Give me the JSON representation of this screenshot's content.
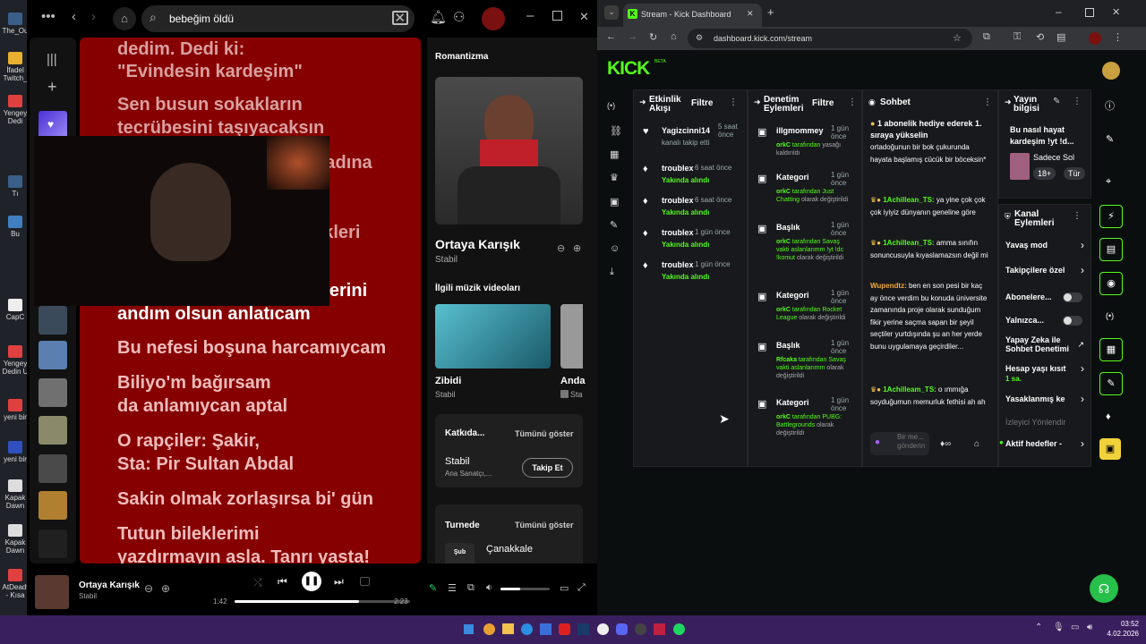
{
  "desktop": {
    "icons": [
      "The_Ou",
      "İfadel Twitch_",
      "Yengey Dedi",
      "Tı",
      "Bu",
      "CapC",
      "Yengey Dedin U",
      "yeni bir",
      "yeni bir",
      "Kapak Dawn",
      "Kapak Dawn",
      "AtDeadt - Kısa"
    ]
  },
  "spotify": {
    "search_text": "bebeğim öldü",
    "lyrics": [
      {
        "text": "dedim. Dedi ki:",
        "state": "past"
      },
      {
        "text": "\"Evindesin kardeşim\"",
        "state": "past"
      },
      {
        "text": "Sen busun sokakların",
        "state": "past"
      },
      {
        "text": "tecrübesini taşıyacaksın",
        "state": "past"
      },
      {
        "text": "o tadına",
        "state": "past"
      },
      {
        "text": "k...",
        "state": "past"
      },
      {
        "text": "çekleri",
        "state": "past"
      },
      {
        "text": "belerini",
        "state": "now"
      },
      {
        "text": "andım olsun anlatıcam",
        "state": "now"
      },
      {
        "text": "Bu nefesi boşuna harcamıycam",
        "state": "fut"
      },
      {
        "text": "Biliyo'm bağırsam",
        "state": "fut"
      },
      {
        "text": "da anlamıycan aptal",
        "state": "fut"
      },
      {
        "text": "O rapçiler: Şakir,",
        "state": "fut"
      },
      {
        "text": "Sta: Pir Sultan Abdal",
        "state": "fut"
      },
      {
        "text": "Sakin olmak zorlaşırsa bi' gün",
        "state": "fut"
      },
      {
        "text": "Tutun bileklerimi",
        "state": "fut"
      },
      {
        "text": "yazdırmayın asla. Tanrı yasta!",
        "state": "fut"
      }
    ],
    "panel": {
      "playlist": "Romantizma",
      "track_title": "Ortaya Karışık",
      "artist": "Stabil",
      "videos_heading": "İlgili müzik videoları",
      "video1_title": "Zibidi",
      "video1_artist": "Stabil",
      "video2_title": "Anda",
      "video2_artist": "Sta",
      "credits_heading": "Katkıda...",
      "credits_show_all": "Tümünü göster",
      "credit_name": "Stabil",
      "credit_role": "Ana Sanatçı,...",
      "follow_label": "Takip Et",
      "tour_heading": "Turnede",
      "tour_show_all": "Tümünü göster",
      "tour_city": "Çanakkale",
      "tour_badge": "Şub"
    },
    "player": {
      "track": "Ortaya Karışık",
      "artist": "Stabil",
      "elapsed": "1:42",
      "duration": "2:23",
      "progress_fraction": 0.71,
      "volume_fraction": 0.4
    }
  },
  "browser": {
    "tab_title": "Stream - Kick Dashboard",
    "url": "dashboard.kick.com/stream",
    "logo": "KICK",
    "logo_sup": "BETA"
  },
  "activity": {
    "heading1": "Etkinlik",
    "heading2": "Akışı",
    "filter": "Filtre",
    "items": [
      {
        "user": "Yagizcinni14",
        "time": "5 saat önce",
        "desc": "kanalı takip etti",
        "icon": "heart"
      },
      {
        "user": "troublex",
        "time": "6 saat önce",
        "desc": "Yakında alındı",
        "icon": "drop"
      },
      {
        "user": "troublex",
        "time": "6 saat önce",
        "desc": "Yakında alındı",
        "icon": "drop"
      },
      {
        "user": "troublex",
        "time": "1 gün önce",
        "desc": "Yakında alındı",
        "icon": "drop"
      },
      {
        "user": "troublex",
        "time": "1 gün önce",
        "desc": "Yakında alındı",
        "icon": "drop"
      }
    ]
  },
  "moderation": {
    "heading1": "Denetim",
    "heading2": "Eylemleri",
    "filter": "Filtre",
    "items": [
      {
        "title": "ilIgmommey",
        "time": "1 gün önce",
        "l1": "orkC",
        "l2": "tarafından",
        "l3": "yasağı kaldırıldı"
      },
      {
        "title": "Kategori",
        "time": "1 gün önce",
        "l1": "orkC",
        "l2": "tarafından Just Chatting",
        "l3": "olarak değiştirildi"
      },
      {
        "title": "Başlık",
        "time": "1 gün önce",
        "l1": "orkC",
        "l2": "tarafından Savaş vakti aslanlarımm !yt !dc !komut",
        "l3": "olarak değiştirildi"
      },
      {
        "title": "Kategori",
        "time": "1 gün önce",
        "l1": "orkC",
        "l2": "tarafından Rocket League",
        "l3": "olarak değiştirildi"
      },
      {
        "title": "Başlık",
        "time": "1 gün önce",
        "l1": "Rfcaka",
        "l2": "tarafından Savaş vakti aslanlarımm",
        "l3": "olarak değiştirildi"
      },
      {
        "title": "Kategori",
        "time": "1 gün önce",
        "l1": "orkC",
        "l2": "tarafından PUBG: Battlegrounds",
        "l3": "olarak değiştirildi"
      }
    ]
  },
  "chat": {
    "heading": "Sohbet",
    "pinned": "1 abonelik hediye ederek 1. sıraya yükselin",
    "messages": [
      {
        "user": "",
        "text": "ortadoğunun bir bok çukurunda hayata başlamış cücük bir böceksin*"
      },
      {
        "user": "1Achillean_TS:",
        "text": "ya yine çok çok çok iyiyiz dünyanın geneline göre"
      },
      {
        "user": "1Achillean_TS:",
        "text": "amma sınıfın sonuncusuyla kıyaslamazsın değil mi"
      },
      {
        "user": "Wupendtz:",
        "text": "ben en son pesi bir kaç ay önce verdim bu konuda üniversite zamanında proje olarak sunduğum fikir yerine saçma sapan bir şeyil seçtiler yurtdışında şu an her yerde bunu uygulamaya geçirdiler..."
      },
      {
        "user": "1Achilleam_TS:",
        "text": "o ımmığa soyduğumun memurluk fethisi ah ah"
      }
    ],
    "input_placeholder": "Bir me... gönderin"
  },
  "stream_info": {
    "heading1": "Yayın",
    "heading2": "bilgisi",
    "title": "Bu nasıl hayat kardeşim !yt !d...",
    "tag1": "Sadece Sol",
    "tag2": "18+",
    "tag3": "Tür"
  },
  "channel_actions": {
    "heading1": "Kanal",
    "heading2": "Eylemleri",
    "items": [
      {
        "label": "Yavaş mod",
        "control": "arrow"
      },
      {
        "label": "Takipçilere özel",
        "control": "arrow"
      },
      {
        "label": "Abonelere...",
        "control": "toggle"
      },
      {
        "label": "Yalnızca...",
        "control": "toggle"
      },
      {
        "label": "Yapay Zeka ile Sohbet Denetimi",
        "control": "external"
      },
      {
        "label": "Hesap yaşı kısıt",
        "control": "arrow"
      },
      {
        "label": "Yasaklanmış ke",
        "control": "arrow"
      },
      {
        "label": "İzleyici Yönlendir",
        "control": "none"
      },
      {
        "label": "Aktif hedefler -",
        "control": "arrow"
      }
    ],
    "account_age_value": "1 sa."
  },
  "taskbar": {
    "time": "03:52",
    "date": "4.02.2026"
  }
}
